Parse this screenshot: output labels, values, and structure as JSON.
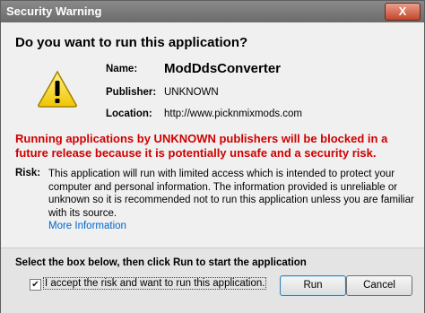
{
  "window": {
    "title": "Security Warning",
    "close_label": "X"
  },
  "main": {
    "question": "Do you want to run this application?",
    "icon": "warning-triangle-icon",
    "fields": {
      "name_label": "Name:",
      "name_value": "ModDdsConverter",
      "publisher_label": "Publisher:",
      "publisher_value": "UNKNOWN",
      "location_label": "Location:",
      "location_value": "http://www.picknmixmods.com"
    },
    "warning": "Running applications by UNKNOWN publishers will be blocked in a future release because it is potentially unsafe and a security risk.",
    "risk_label": "Risk:",
    "risk_text": "This application will run with limited access which is intended to protect your computer and personal information. The information provided is unreliable or unknown so it is recommended not to run this application unless you are familiar with its source.",
    "more_info": "More Information"
  },
  "footer": {
    "instruction": "Select the box below, then click Run to start the application",
    "checkbox_label": "I accept the risk and want to run this application.",
    "checkbox_checked": true,
    "run_label": "Run",
    "cancel_label": "Cancel"
  },
  "colors": {
    "warning_text": "#d00000",
    "link": "#0066cc",
    "titlebar": "#7a7a7a"
  }
}
